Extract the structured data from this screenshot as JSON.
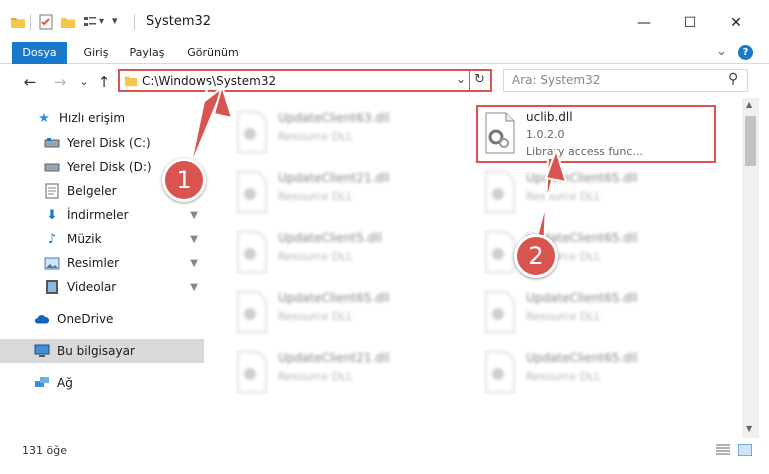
{
  "window": {
    "title": "System32",
    "minimize_glyph": "—",
    "maximize_glyph": "☐",
    "close_glyph": "✕",
    "help_glyph": "?",
    "collapse_glyph": "⌄"
  },
  "ribbon": {
    "tabs": [
      {
        "label": "Dosya",
        "active": true
      },
      {
        "label": "Giriş"
      },
      {
        "label": "Paylaş"
      },
      {
        "label": "Görünüm"
      }
    ]
  },
  "nav": {
    "back_glyph": "←",
    "forward_glyph": "→",
    "recent_glyph": "⌄",
    "up_glyph": "↑",
    "address": "C:\\Windows\\System32",
    "address_dropdown_glyph": "⌄",
    "refresh_glyph": "↻",
    "search_placeholder": "Ara: System32",
    "search_glyph": "⚲"
  },
  "sidebar": {
    "items": [
      {
        "label": "Hızlı erişim",
        "icon": "star-icon"
      },
      {
        "label": "Yerel Disk (C:)",
        "icon": "drive-icon",
        "pinned": true
      },
      {
        "label": "Yerel Disk (D:)",
        "icon": "drive-icon",
        "pinned": true
      },
      {
        "label": "Belgeler",
        "icon": "documents-icon",
        "pinned": true
      },
      {
        "label": "İndirmeler",
        "icon": "downloads-icon",
        "pinned": true
      },
      {
        "label": "Müzik",
        "icon": "music-icon",
        "pinned": true
      },
      {
        "label": "Resimler",
        "icon": "pictures-icon",
        "pinned": true
      },
      {
        "label": "Videolar",
        "icon": "videos-icon",
        "pinned": true
      },
      {
        "label": "OneDrive",
        "icon": "onedrive-icon"
      },
      {
        "label": "Bu bilgisayar",
        "icon": "computer-icon",
        "selected": true
      },
      {
        "label": "Ağ",
        "icon": "network-icon"
      }
    ],
    "pin_glyph": "📌"
  },
  "files": {
    "highlighted": {
      "name": "uclib.dll",
      "version": "1.0.2.0",
      "description": "Library access func..."
    },
    "left_column": [
      {
        "name": "UpdateClient63.dll",
        "type": "Resource DLL"
      },
      {
        "name": "UpdateClient21.dll",
        "type": "Resource DLL"
      },
      {
        "name": "UpdateClient5.dll",
        "type": "Resource DLL"
      },
      {
        "name": "UpdateClient65.dll",
        "type": "Resource DLL"
      },
      {
        "name": "UpdateClient21.dll",
        "type": "Resource DLL"
      }
    ],
    "right_column": [
      {
        "name": "UpdateClient65.dll",
        "type": "Resource DLL"
      },
      {
        "name": "UpdateClient65.dll",
        "type": "Resource DLL"
      },
      {
        "name": "UpdateClient65.dll",
        "type": "Resource DLL"
      },
      {
        "name": "UpdateClient65.dll",
        "type": "Resource DLL"
      }
    ]
  },
  "status": {
    "item_count": "131 öğe"
  },
  "annotations": {
    "step1": "1",
    "step2": "2",
    "accent": "#d9534f"
  },
  "colors": {
    "file_tab": "#1979ca",
    "highlight": "#d9534f",
    "selected_nav": "#d9d9d9"
  }
}
